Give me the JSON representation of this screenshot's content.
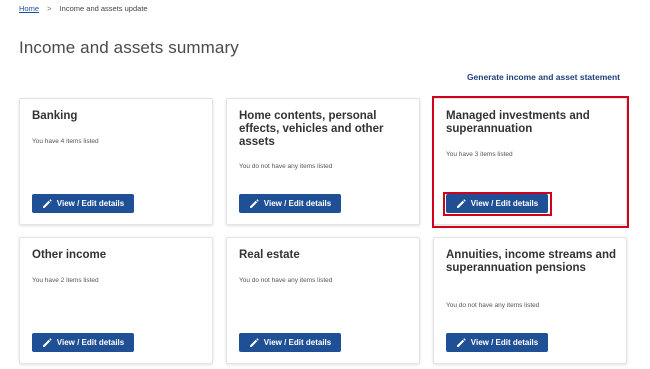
{
  "breadcrumb": {
    "home": "Home",
    "separator": ">",
    "current": "Income and assets update"
  },
  "page_title": "Income and assets summary",
  "generate_link": "Generate income and asset statement",
  "button_label": "View / Edit details",
  "cards": [
    {
      "title": "Banking",
      "status": "You have 4 items listed"
    },
    {
      "title": "Home contents, personal effects, vehicles and other assets",
      "status": "You do not have any items listed"
    },
    {
      "title": "Managed investments and superannuation",
      "status": "You have 3 items listed"
    },
    {
      "title": "Other income",
      "status": "You have 2 items listed"
    },
    {
      "title": "Real estate",
      "status": "You do not have any items listed"
    },
    {
      "title": "Annuities, income streams and superannuation pensions",
      "status": "You do not have any items listed"
    }
  ],
  "colors": {
    "button": "#1f4f95",
    "highlight": "#d0021b",
    "link": "#1d3f7a"
  },
  "icons": {
    "button_icon": "pencil-icon"
  }
}
